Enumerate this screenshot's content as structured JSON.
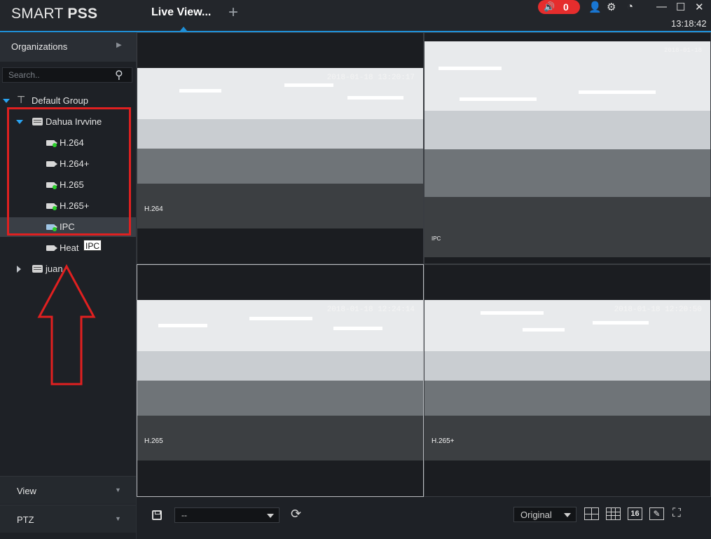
{
  "app": {
    "brand_light": "SMART ",
    "brand_bold": "PSS",
    "active_tab": "Live View...",
    "add_tab_symbol": "+",
    "alarm_count": "0",
    "clock": "13:18:42",
    "accent_color": "#1f8fd6",
    "alarm_color": "#e52d2d"
  },
  "titlebar_icons": [
    {
      "name": "user-icon",
      "glyph": "👤"
    },
    {
      "name": "settings-icon",
      "glyph": "⚙"
    },
    {
      "name": "performance-icon",
      "glyph": "◔"
    },
    {
      "name": "minimize-icon",
      "glyph": "—"
    },
    {
      "name": "maximize-icon",
      "glyph": "☐"
    },
    {
      "name": "close-icon",
      "glyph": "✕"
    }
  ],
  "sidebar": {
    "header": "Organizations",
    "search_placeholder": "Search..",
    "root_group": "Default Group",
    "device_group": "Dahua Irvvine",
    "channels": [
      {
        "label": "H.264",
        "online": true
      },
      {
        "label": "H.264+",
        "online": false
      },
      {
        "label": "H.265",
        "online": true
      },
      {
        "label": "H.265+",
        "online": true
      },
      {
        "label": "IPC",
        "online": true,
        "selected": true
      },
      {
        "label": "Heat",
        "online": false
      }
    ],
    "tooltip": "IPC",
    "second_group": "juan",
    "footer_view": "View",
    "footer_ptz": "PTZ",
    "annotation_color": "#e02020"
  },
  "feeds": [
    {
      "id": "top-left",
      "timestamp": "2018-01-18 13:20:17",
      "name": "H.264"
    },
    {
      "id": "top-right",
      "timestamp": "2018-01-18",
      "name": "IPC"
    },
    {
      "id": "bottom-left",
      "timestamp": "2018-01-18 12:24:14",
      "name": "H.265"
    },
    {
      "id": "bottom-right",
      "timestamp": "2018-01-18 12:20:50",
      "name": "H.265+"
    }
  ],
  "bottombar": {
    "layout_value": "--",
    "ratio_value": "Original",
    "grid16_label": "16",
    "edit_glyph": "✎",
    "fullscreen_glyph": "⛶",
    "refresh_glyph": "⟳"
  }
}
